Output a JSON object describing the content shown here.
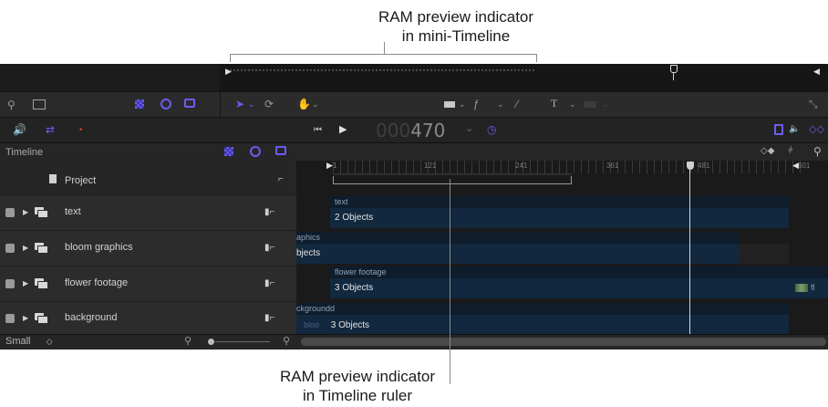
{
  "callouts": {
    "top_line1": "RAM preview indicator",
    "top_line2": "in mini-Timeline",
    "bottom_line1": "RAM preview indicator",
    "bottom_line2": "in Timeline ruler"
  },
  "transport": {
    "timecode_dim": "000",
    "timecode_value": "470",
    "timecode_menu": "⌄"
  },
  "timeline": {
    "panel_title": "Timeline",
    "ruler_marks": [
      "1",
      "121",
      "241",
      "361",
      "481",
      "601"
    ]
  },
  "layers": [
    {
      "label": "Project"
    },
    {
      "label": "text"
    },
    {
      "label": "bloom graphics"
    },
    {
      "label": "flower footage"
    },
    {
      "label": "background"
    }
  ],
  "tracks": {
    "text_label": "text",
    "text_objects": "2 Objects",
    "bloom_label_partial": "aphics",
    "bloom_objects_partial": "bjects",
    "flower_label": "flower footage",
    "flower_objects": "3 Objects",
    "flower_thumb_text": "fl",
    "bg_label": "ckground",
    "bg_label_end": "d",
    "bg_sub_partial": "bloo",
    "bg_objects": "3 Objects"
  },
  "bottom_bar": {
    "size_select": "Small",
    "size_chevron": "◇"
  },
  "colors": {
    "accent_purple": "#6b5cf0",
    "loop_blue": "#6b5cf0",
    "record_red": "#d9433a",
    "track_dark": "#12283e",
    "playhead": "#d8d8d8"
  }
}
